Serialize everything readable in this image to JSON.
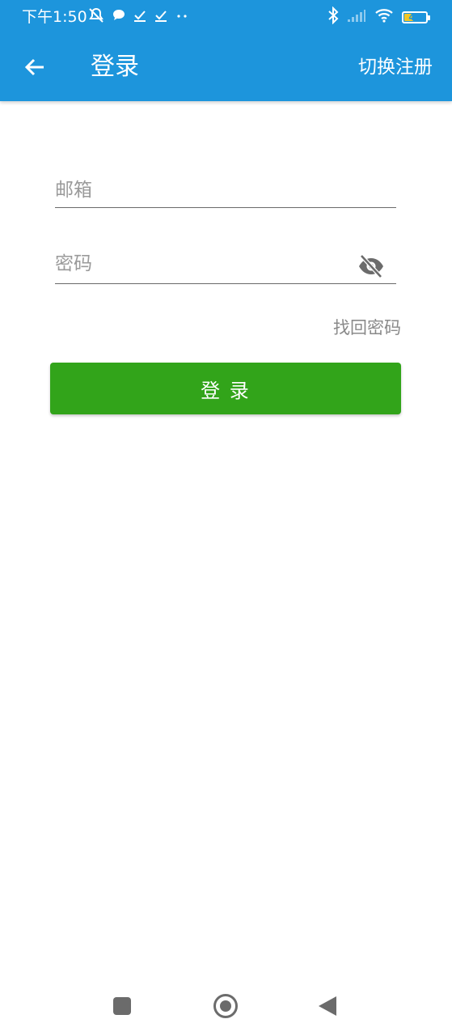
{
  "status_bar": {
    "time": "下午1:50",
    "battery_level": "42",
    "icons": [
      "mute-bell-icon",
      "chat-bubble-icon",
      "download-done-icon",
      "download-done-icon",
      "more-dots-icon",
      "bluetooth-icon",
      "signal-icon",
      "wifi-icon",
      "battery-icon"
    ]
  },
  "appbar": {
    "title": "登录",
    "switch_label": "切换注册",
    "back_icon": "arrow-left-icon"
  },
  "form": {
    "email_placeholder": "邮箱",
    "email_value": "",
    "password_placeholder": "密码",
    "password_value": "",
    "visibility_icon": "eye-off-icon",
    "forgot_label": "找回密码",
    "login_label": "登 录"
  },
  "nav_bar": {
    "icons": [
      "recent-apps-icon",
      "home-icon",
      "back-triangle-icon"
    ]
  },
  "colors": {
    "primary": "#1d95dc",
    "login_button": "#32a41a",
    "hint_text": "#9a9a9a"
  }
}
